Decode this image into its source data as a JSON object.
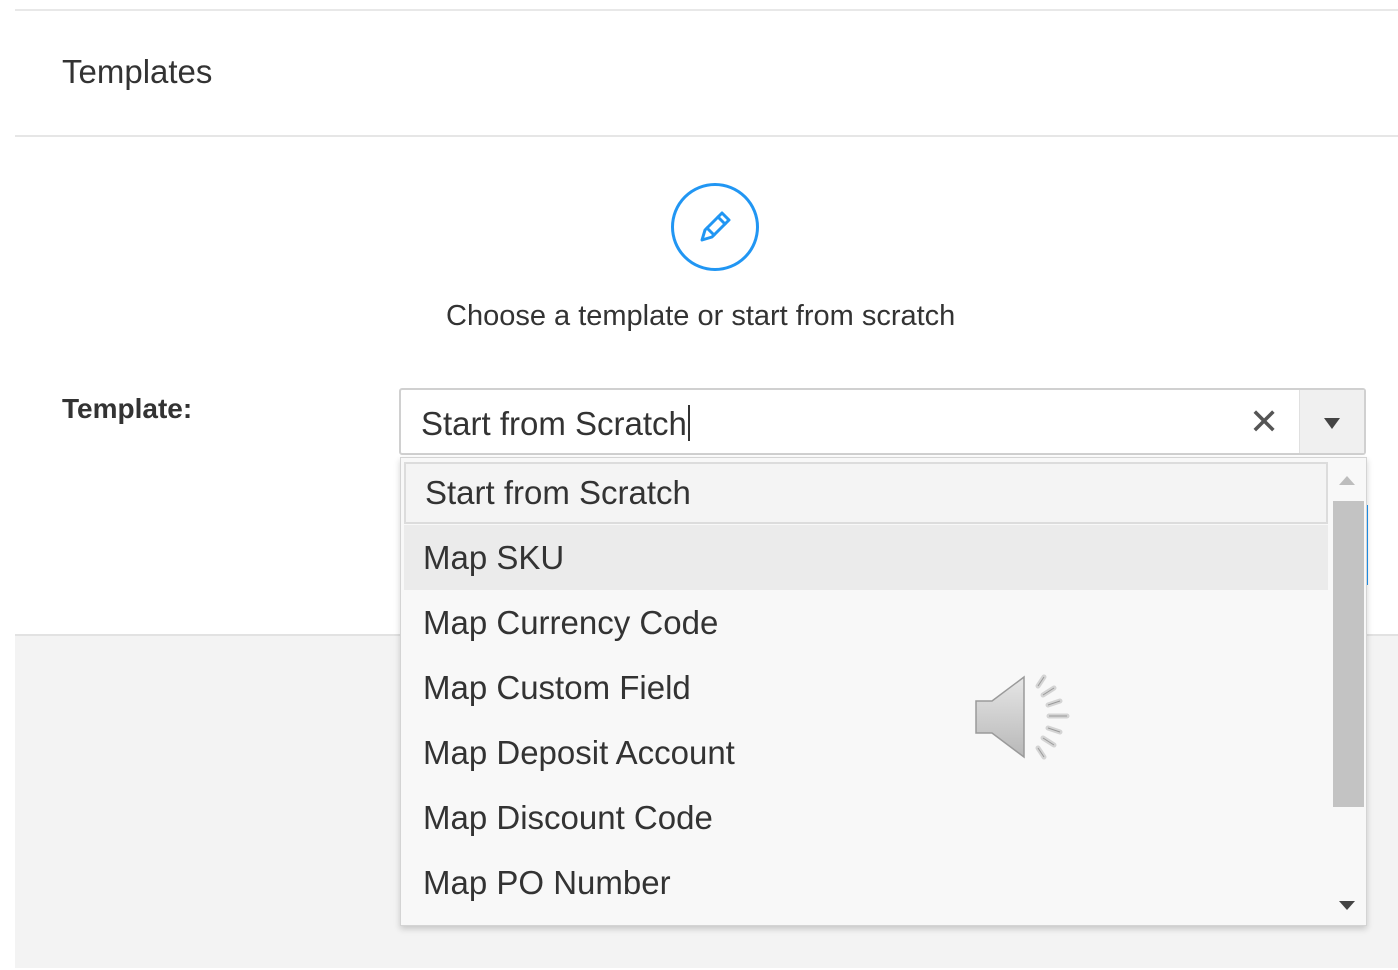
{
  "header": {
    "title": "Templates"
  },
  "main": {
    "icon": "pencil-icon",
    "subtitle": "Choose a template or start from scratch",
    "template_label": "Template:"
  },
  "template_select": {
    "value": "Start from Scratch",
    "clear_symbol": "✕",
    "options": [
      "Start from Scratch",
      "Map SKU",
      "Map Currency Code",
      "Map Custom Field",
      "Map Deposit Account",
      "Map Discount Code",
      "Map PO Number"
    ],
    "selected_index": 0,
    "hover_index": 1
  },
  "overlay": {
    "icon": "speaker-icon"
  },
  "colors": {
    "accent": "#2196f3",
    "footer_bg": "#f3f3f3",
    "dropdown_bg": "#f8f8f8"
  }
}
